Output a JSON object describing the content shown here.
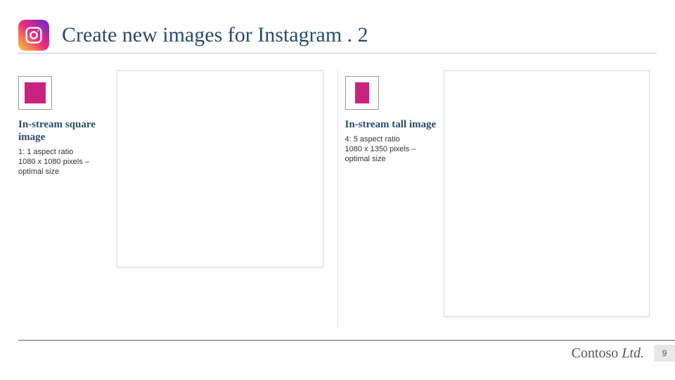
{
  "header": {
    "title": "Create new images for Instagram . 2"
  },
  "left": {
    "title": "In-stream square image",
    "spec1": "1: 1 aspect ratio",
    "spec2": "1080 x 1080 pixels – optimal size"
  },
  "right": {
    "title": "In-stream tall image",
    "spec1": "4: 5 aspect ratio",
    "spec2": "1080 x 1350 pixels – optimal size"
  },
  "footer": {
    "company_main": "Contoso ",
    "company_ltd": "Ltd.",
    "page": "9"
  }
}
